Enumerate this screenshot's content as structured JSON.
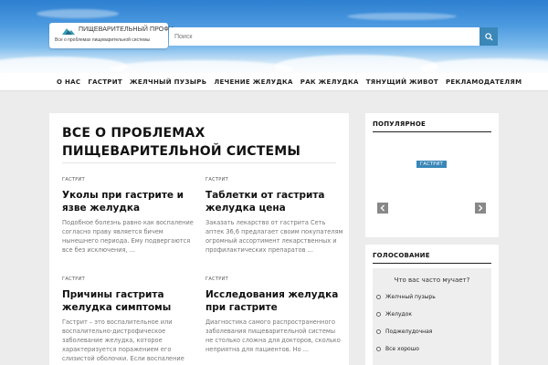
{
  "header": {
    "logo_title": "ПИЩЕВАРИТЕЛЬНЫЙ ПРОФИ",
    "logo_subtitle": "Все о проблемах пищеварительной системы",
    "logo_icon": "mountain-logo-icon",
    "search_placeholder": "Поиск",
    "search_icon": "search-icon"
  },
  "nav": {
    "items": [
      "О НАС",
      "ГАСТРИТ",
      "ЖЕЛЧНЫЙ ПУЗЫРЬ",
      "ЛЕЧЕНИЕ ЖЕЛУДКА",
      "РАК ЖЕЛУДКА",
      "ТЯНУЩИЙ ЖИВОТ",
      "РЕКЛАМОДАТЕЛЯМ"
    ]
  },
  "main": {
    "title": "ВСЕ О ПРОБЛЕМАХ ПИЩЕВАРИТЕЛЬНОЙ СИСТЕМЫ",
    "articles": [
      {
        "category": "ГАСТРИТ",
        "title": "Уколы при гастрите и язве желудка",
        "excerpt": "Подобное болезнь равно как воспаление согласно праву является бичем нынешнего периода. Ему подвергаются все без исключения, ..."
      },
      {
        "category": "ГАСТРИТ",
        "title": "Таблетки от гастрита желудка цена",
        "excerpt": "Заказать лекарство от гастрита Сеть аптек 36,6 предлагает своим покупателям огромный ассортимент лекарственных и профилактических препаратов ..."
      },
      {
        "category": "ГАСТРИТ",
        "title": "Причины гастрита желудка симптомы",
        "excerpt": "Гастрит – это воспалительное или воспалительно-дистрофическое заболевание желудка, которое характеризуется поражением его слизистой оболочки. Если воспаление распространяется ..."
      },
      {
        "category": "ГАСТРИТ",
        "title": "Исследования желудка при гастрите",
        "excerpt": "Диагностика самого распространенного заболевания пищеварительной системы не столько сложна для докторов, сколько неприятна для пациентов. Но ..."
      }
    ]
  },
  "sidebar": {
    "popular": {
      "title": "ПОПУЛЯРНОЕ",
      "badge": "ГАСТРИТ",
      "prev_icon": "chevron-left-icon",
      "next_icon": "chevron-right-icon"
    },
    "poll": {
      "title": "ГОЛОСОВАНИЕ",
      "question": "Что вас часто мучает?",
      "options": [
        "Желчный пузырь",
        "Желудок",
        "Поджелудочная",
        "Все хорошо"
      ]
    }
  },
  "colors": {
    "accent": "#3a87b8",
    "background": "#ececec"
  }
}
